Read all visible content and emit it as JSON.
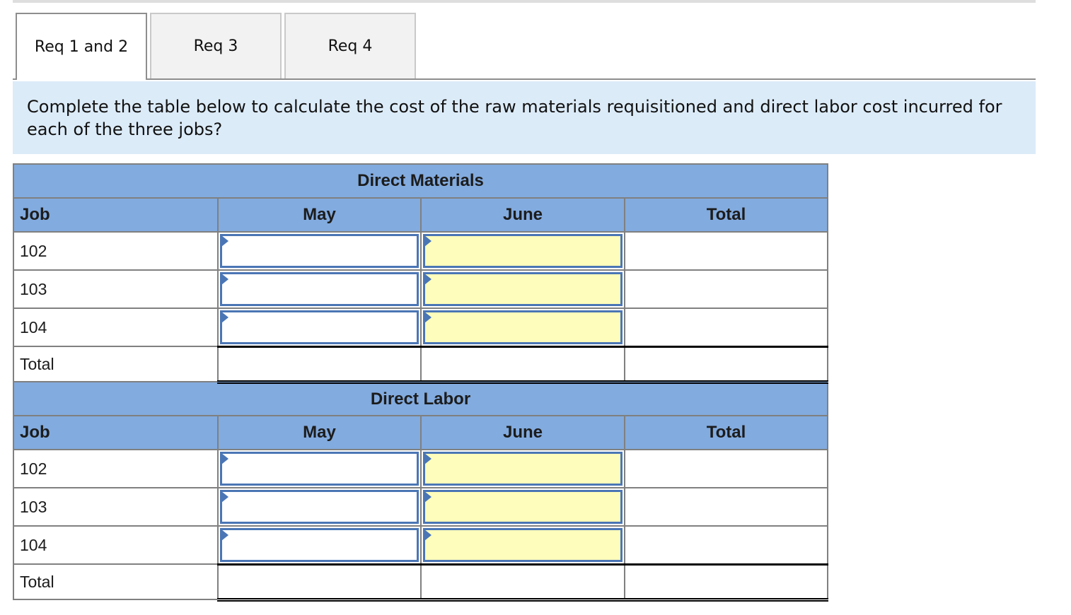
{
  "tabs": [
    {
      "label": "Req 1 and 2",
      "active": true
    },
    {
      "label": "Req 3",
      "active": false
    },
    {
      "label": "Req 4",
      "active": false
    }
  ],
  "instruction": "Complete the table below to calculate the cost of the raw materials requisitioned and direct labor cost incurre each of the three jobs?",
  "instruction_lines": [
    "Complete the table below to calculate the cost of the raw materials requisitioned and direct labor cost incurred for",
    "each of the three jobs?"
  ],
  "colors": {
    "header_bg": "#82abdf",
    "instruction_bg": "#dcebf8",
    "input_border": "#4b76b5",
    "input_yellow": "#fffdbb",
    "tab_inactive_bg": "#f2f2f2"
  },
  "sections": [
    {
      "title": "Direct Materials",
      "columns": [
        "Job",
        "May",
        "June",
        "Total"
      ],
      "rows": [
        {
          "job": "102",
          "may": "",
          "june": "",
          "total": ""
        },
        {
          "job": "103",
          "may": "",
          "june": "",
          "total": ""
        },
        {
          "job": "104",
          "may": "",
          "june": "",
          "total": ""
        }
      ],
      "total_row": {
        "label": "Total",
        "may": "",
        "june": "",
        "total": ""
      }
    },
    {
      "title": "Direct Labor",
      "columns": [
        "Job",
        "May",
        "June",
        "Total"
      ],
      "rows": [
        {
          "job": "102",
          "may": "",
          "june": "",
          "total": ""
        },
        {
          "job": "103",
          "may": "",
          "june": "",
          "total": ""
        },
        {
          "job": "104",
          "may": "",
          "june": "",
          "total": ""
        }
      ],
      "total_row": {
        "label": "Total",
        "may": "",
        "june": "",
        "total": ""
      }
    }
  ]
}
